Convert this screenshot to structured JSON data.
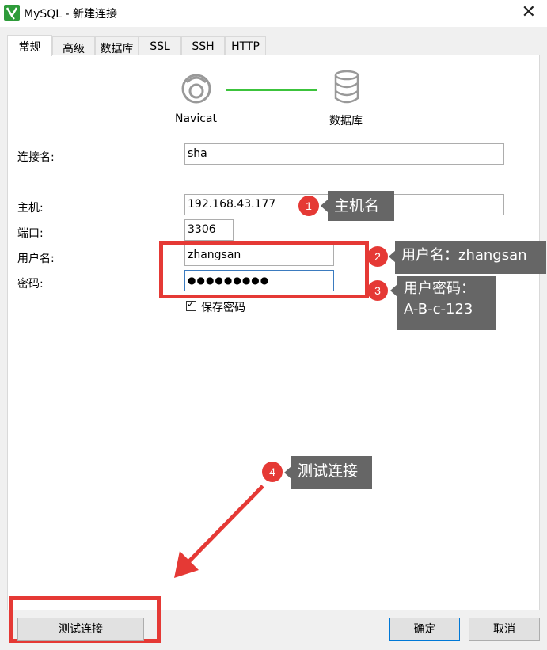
{
  "window": {
    "title": "MySQL - 新建连接",
    "close_symbol": "✕"
  },
  "tabs": [
    "常规",
    "高级",
    "数据库",
    "SSL",
    "SSH",
    "HTTP"
  ],
  "diagram": {
    "left_label": "Navicat",
    "right_label": "数据库",
    "line_color": "#3cc33c"
  },
  "form": {
    "connection_name_label": "连接名:",
    "connection_name_value": "sha",
    "host_label": "主机:",
    "host_value": "192.168.43.177",
    "port_label": "端口:",
    "port_value": "3306",
    "user_label": "用户名:",
    "user_value": "zhangsan",
    "password_label": "密码:",
    "password_value": "●●●●●●●●●",
    "save_password_label": "保存密码",
    "save_password_checked": true
  },
  "annotations": {
    "badges": [
      "1",
      "2",
      "3",
      "4"
    ],
    "tip1": "主机名",
    "tip2": "用户名：zhangsan",
    "tip3_line1": "用户密码：",
    "tip3_line2": "A-B-c-123",
    "tip4": "测试连接",
    "highlight_color": "#e53935"
  },
  "buttons": {
    "test": "测试连接",
    "ok": "确定",
    "cancel": "取消"
  }
}
